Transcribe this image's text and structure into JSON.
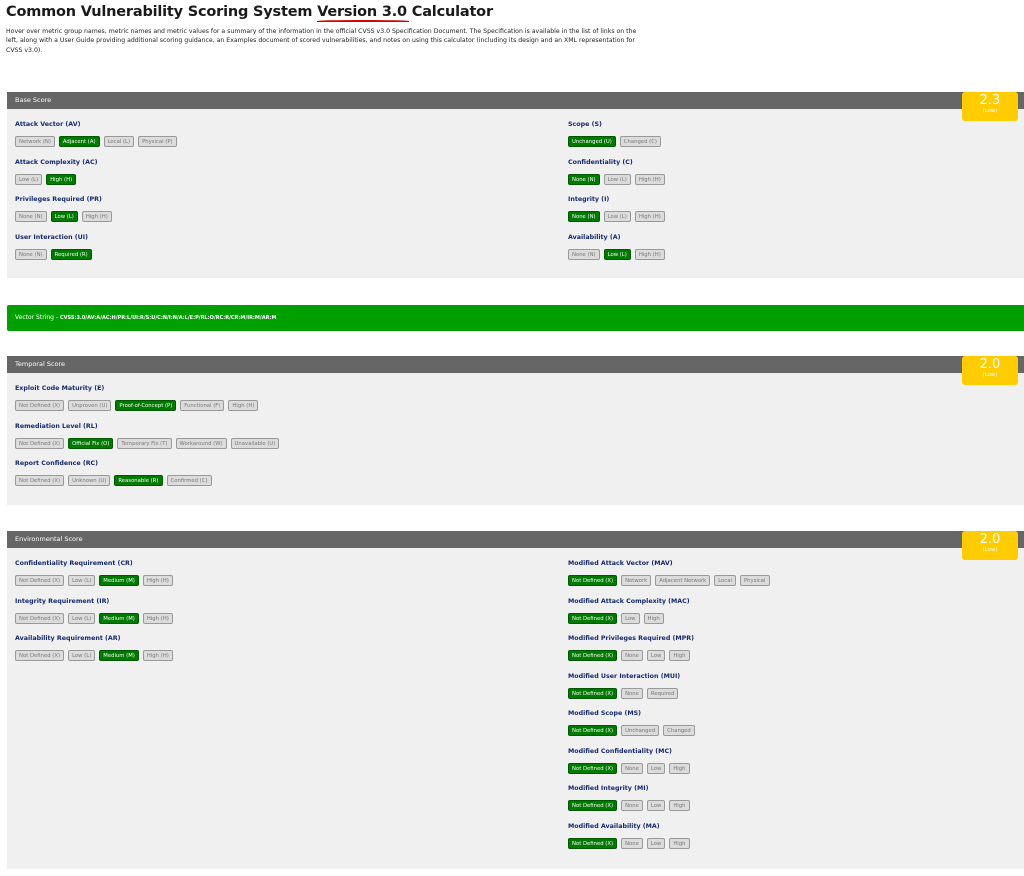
{
  "page": {
    "title_prefix": "Common Vulnerability Scoring System ",
    "title_version": "Version 3.0",
    "title_suffix": " Calculator",
    "intro": "Hover over metric group names, metric names and metric values for a summary of the information in the official CVSS v3.0 Specification Document. The Specification is available in the list of links on the left, along with a User Guide providing additional scoring guidance, an Examples document of scored vulnerabilities, and notes on using this calculator (including its design and an XML representation for CVSS v3.0)."
  },
  "colors": {
    "section_header": "#666666",
    "selected": "#007a00",
    "unselected": "#dcdcdc",
    "score_badge": "#ffcc00",
    "vector_bar": "#00a000"
  },
  "base": {
    "title": "Base Score",
    "score": "2.3",
    "severity": "(Low)",
    "left": [
      {
        "name": "Attack Vector (AV)",
        "options": [
          "Network (N)",
          "Adjacent (A)",
          "Local (L)",
          "Physical (P)"
        ],
        "selected": 1
      },
      {
        "name": "Attack Complexity (AC)",
        "options": [
          "Low (L)",
          "High (H)"
        ],
        "selected": 1
      },
      {
        "name": "Privileges Required (PR)",
        "options": [
          "None (N)",
          "Low (L)",
          "High (H)"
        ],
        "selected": 1
      },
      {
        "name": "User Interaction (UI)",
        "options": [
          "None (N)",
          "Required (R)"
        ],
        "selected": 1
      }
    ],
    "right": [
      {
        "name": "Scope (S)",
        "options": [
          "Unchanged (U)",
          "Changed (C)"
        ],
        "selected": 0
      },
      {
        "name": "Confidentiality (C)",
        "options": [
          "None (N)",
          "Low (L)",
          "High (H)"
        ],
        "selected": 0
      },
      {
        "name": "Integrity (I)",
        "options": [
          "None (N)",
          "Low (L)",
          "High (H)"
        ],
        "selected": 0
      },
      {
        "name": "Availability (A)",
        "options": [
          "None (N)",
          "Low (L)",
          "High (H)"
        ],
        "selected": 1
      }
    ]
  },
  "vector": {
    "label": "Vector String - ",
    "value": "CVSS:3.0/AV:A/AC:H/PR:L/UI:R/S:U/C:N/I:N/A:L/E:P/RL:O/RC:R/CR:M/IR:M/AR:M"
  },
  "temporal": {
    "title": "Temporal Score",
    "score": "2.0",
    "severity": "(Low)",
    "left": [
      {
        "name": "Exploit Code Maturity (E)",
        "options": [
          "Not Defined (X)",
          "Unproven (U)",
          "Proof-of-Concept (P)",
          "Functional (F)",
          "High (H)"
        ],
        "selected": 2
      },
      {
        "name": "Remediation Level (RL)",
        "options": [
          "Not Defined (X)",
          "Official Fix (O)",
          "Temporary Fix (T)",
          "Workaround (W)",
          "Unavailable (U)"
        ],
        "selected": 1
      },
      {
        "name": "Report Confidence (RC)",
        "options": [
          "Not Defined (X)",
          "Unknown (U)",
          "Reasonable (R)",
          "Confirmed (C)"
        ],
        "selected": 2
      }
    ]
  },
  "environmental": {
    "title": "Environmental Score",
    "score": "2.0",
    "severity": "(Low)",
    "left": [
      {
        "name": "Confidentiality Requirement (CR)",
        "options": [
          "Not Defined (X)",
          "Low (L)",
          "Medium (M)",
          "High (H)"
        ],
        "selected": 2
      },
      {
        "name": "Integrity Requirement (IR)",
        "options": [
          "Not Defined (X)",
          "Low (L)",
          "Medium (M)",
          "High (H)"
        ],
        "selected": 2
      },
      {
        "name": "Availability Requirement (AR)",
        "options": [
          "Not Defined (X)",
          "Low (L)",
          "Medium (M)",
          "High (H)"
        ],
        "selected": 2
      }
    ],
    "right": [
      {
        "name": "Modified Attack Vector (MAV)",
        "options": [
          "Not Defined (X)",
          "Network",
          "Adjacent Network",
          "Local",
          "Physical"
        ],
        "selected": 0
      },
      {
        "name": "Modified Attack Complexity (MAC)",
        "options": [
          "Not Defined (X)",
          "Low",
          "High"
        ],
        "selected": 0
      },
      {
        "name": "Modified Privileges Required (MPR)",
        "options": [
          "Not Defined (X)",
          "None",
          "Low",
          "High"
        ],
        "selected": 0
      },
      {
        "name": "Modified User Interaction (MUI)",
        "options": [
          "Not Defined (X)",
          "None",
          "Required"
        ],
        "selected": 0
      },
      {
        "name": "Modified Scope (MS)",
        "options": [
          "Not Defined (X)",
          "Unchanged",
          "Changed"
        ],
        "selected": 0
      },
      {
        "name": "Modified Confidentiality (MC)",
        "options": [
          "Not Defined (X)",
          "None",
          "Low",
          "High"
        ],
        "selected": 0
      },
      {
        "name": "Modified Integrity (MI)",
        "options": [
          "Not Defined (X)",
          "None",
          "Low",
          "High"
        ],
        "selected": 0
      },
      {
        "name": "Modified Availability (MA)",
        "options": [
          "Not Defined (X)",
          "None",
          "Low",
          "High"
        ],
        "selected": 0
      }
    ]
  }
}
